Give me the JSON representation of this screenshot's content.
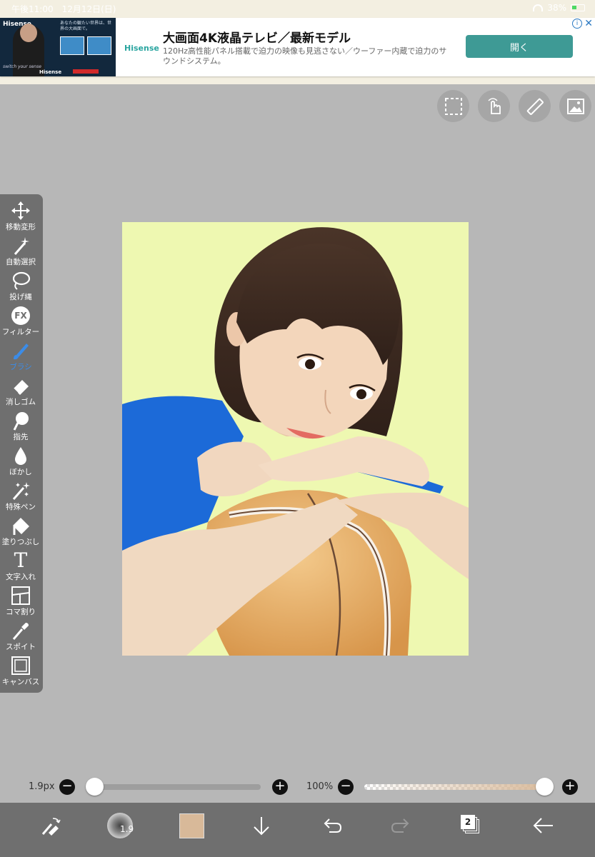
{
  "status": {
    "time": "午後11:00　12月12日(日)",
    "battery": "38%"
  },
  "ad": {
    "brand": "Hisense",
    "left_copy": "あなたの観たい世界は、世界の大画面で。",
    "tagline": "switch your sense",
    "title": "大画面4K液晶テレビ／最新モデル",
    "description": "120Hz高性能パネル搭載で迫力の映像も見逃さない／ウーファー内蔵で迫力のサウンドシステム。",
    "cta": "開く",
    "info": "i",
    "close": "✕"
  },
  "tools": [
    {
      "label": "移動変形",
      "icon": "move-icon"
    },
    {
      "label": "自動選択",
      "icon": "magic-wand-icon"
    },
    {
      "label": "投げ縄",
      "icon": "lasso-icon"
    },
    {
      "label": "フィルター",
      "icon": "fx-icon",
      "glyph": "FX"
    },
    {
      "label": "ブラシ",
      "icon": "brush-icon",
      "active": true
    },
    {
      "label": "消しゴム",
      "icon": "eraser-icon"
    },
    {
      "label": "指先",
      "icon": "smudge-icon"
    },
    {
      "label": "ぼかし",
      "icon": "blur-drop-icon"
    },
    {
      "label": "特殊ペン",
      "icon": "sparkle-pen-icon"
    },
    {
      "label": "塗りつぶし",
      "icon": "bucket-icon"
    },
    {
      "label": "文字入れ",
      "icon": "text-icon",
      "glyph": "T"
    },
    {
      "label": "コマ割り",
      "icon": "panel-icon"
    },
    {
      "label": "スポイト",
      "icon": "eyedropper-icon"
    },
    {
      "label": "キャンバス",
      "icon": "canvas-icon"
    }
  ],
  "brush": {
    "size_label": "1.9px",
    "size_badge": "1.9",
    "size_fraction": 0.0,
    "opacity_label": "100%",
    "opacity_fraction": 1.0,
    "minus": "−",
    "plus": "+"
  },
  "colors": {
    "current_color": "#d8b999",
    "accent": "#3b8ce8"
  },
  "layers": {
    "count": "2"
  }
}
